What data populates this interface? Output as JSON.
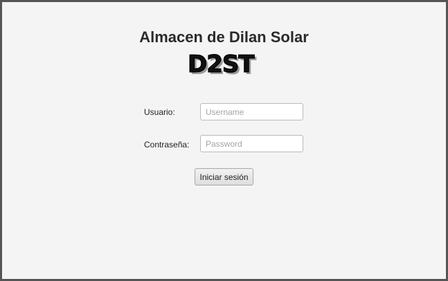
{
  "app": {
    "title": "Almacen de Dilan Solar",
    "logo_text": "D2ST"
  },
  "form": {
    "username_label": "Usuario:",
    "username_placeholder": "Username",
    "username_value": "",
    "password_label": "Contraseña:",
    "password_placeholder": "Password",
    "password_value": "",
    "login_button_label": "Iniciar sesión"
  }
}
